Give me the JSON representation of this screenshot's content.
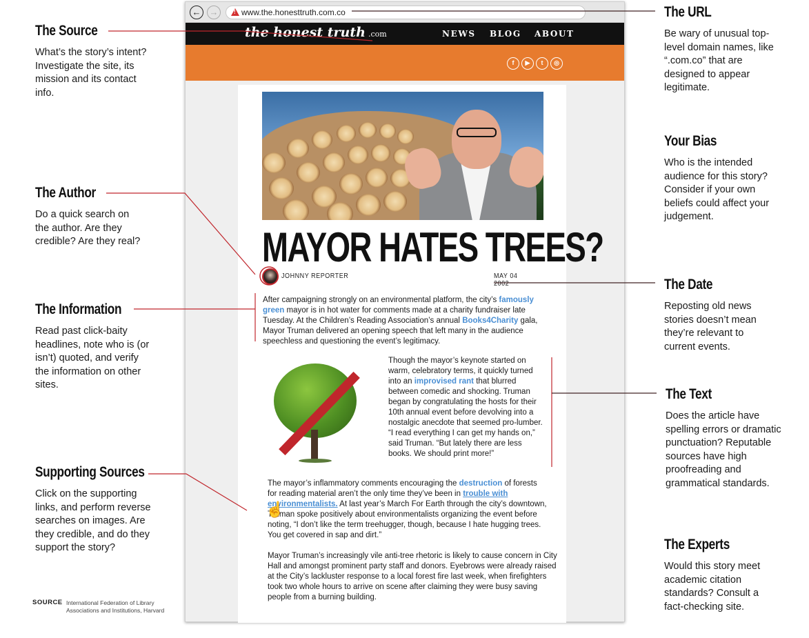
{
  "annotations": {
    "source": {
      "title": "The Source",
      "body": "What’s the story’s intent? Investigate the site, its mission and its contact info."
    },
    "author": {
      "title": "The Author",
      "body": "Do a quick search on the author. Are they credible? Are they real?"
    },
    "information": {
      "title": "The Information",
      "body": "Read past click-baity headlines, note who is (or isn’t) quoted, and verify the information on other sites."
    },
    "supporting": {
      "title": "Supporting Sources",
      "body": "Click on the supporting links, and perform reverse searches on images. Are they credible, and do they support the story?"
    },
    "url": {
      "title": "The URL",
      "body": "Be wary of unusual top-level domain names, like “.com.co” that are designed to appear legitimate."
    },
    "bias": {
      "title": "Your Bias",
      "body": "Who is the intended audience for this story? Consider if your own beliefs could affect your judgement."
    },
    "date": {
      "title": "The Date",
      "body": "Reposting old news stories doesn’t mean they’re relevant to current events."
    },
    "text": {
      "title": "The Text",
      "body": "Does the article have spelling errors or dramatic punctuation? Reputable sources have high proofreading and grammatical standards."
    },
    "experts": {
      "title": "The Experts",
      "body": "Would this story meet academic citation standards? Consult a fact-checking site."
    }
  },
  "source_note": {
    "label": "SOURCE",
    "text": "International Federation of Library Associations and Institutions, Harvard"
  },
  "browser": {
    "back_icon": "←",
    "forward_icon": "→",
    "url": "www.the.honesttruth.com.co",
    "warning_icon": "!"
  },
  "site": {
    "logo": "the honest truth",
    "logo_tld": ".com",
    "menu": [
      "NEWS",
      "BLOG",
      "ABOUT"
    ],
    "social_icons": [
      "facebook-icon",
      "youtube-icon",
      "twitter-icon",
      "instagram-icon"
    ],
    "social_glyphs": [
      "f",
      "▶",
      "t",
      "◎"
    ]
  },
  "article": {
    "headline": "MAYOR HATES TREES?",
    "author": "JOHNNY REPORTER",
    "date": "MAY 04 2002",
    "p1": {
      "a": "After campaigning strongly on an environmental platform, the city’s ",
      "link1": "famously green",
      "b": " mayor is in hot water for comments made at a charity fundraiser late Tuesday. At the Children’s Reading Association’s annual ",
      "link2": "Books4Charity",
      "c": " gala, Mayor Truman delivered an opening speech that left many in the audience speechless and questioning the event’s legitimacy."
    },
    "p2": {
      "a": "Though the mayor’s keynote started on warm, celebratory terms, it quickly turned into an ",
      "link1": "improvised rant",
      "b": " that blurred between comedic and shocking. Truman began by congratulating the hosts for their 10th annual event before devolving into a nostalgic anecdote that seemed pro-lumber. “I read everything I can get my hands on,” said Truman. “But lately there are less books. We should print more!”"
    },
    "p3": {
      "a": "The mayor’s inflammatory comments encouraging the ",
      "link1": "destruction",
      "b": " of forests for reading material aren’t the only time they’ve been in ",
      "link2": "trouble with environmentalists.",
      "c": " At last year’s March For Earth through the city’s downtown, Truman spoke positively about environmentalists organizing the event before noting, “I don’t like the term treehugger, though, because I hate hugging trees. You get covered in sap and dirt.”"
    },
    "p4": "Mayor Truman’s increasingly vile anti-tree rhetoric is likely to cause concern in City Hall and amongst prominent party staff and donors. Eyebrows were already raised at the City’s lackluster response to a local forest fire last week, when firefighters took two whole hours to arrive on scene after claiming they were busy saving people from a burning building."
  },
  "colors": {
    "accent_red": "#c0262c",
    "site_orange": "#e77b2e",
    "link_blue": "#4a8fd4",
    "nav_black": "#111111"
  }
}
